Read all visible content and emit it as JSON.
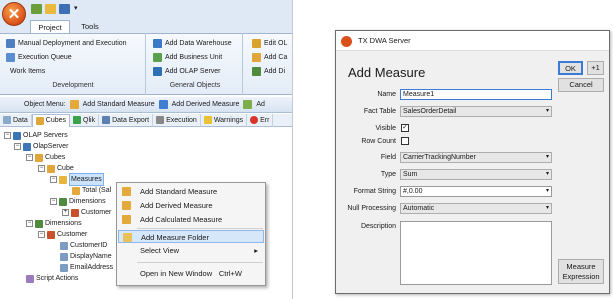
{
  "ribbon": {
    "tabs": [
      "Project",
      "Tools"
    ],
    "development": {
      "items": [
        "Manual Deployment and Execution",
        "Execution Queue",
        "Work Items"
      ],
      "label": "Development"
    },
    "general_objects": {
      "items": [
        "Add Data Warehouse",
        "Add Business Unit",
        "Add OLAP Server"
      ],
      "label": "General Objects"
    },
    "extra": {
      "items": [
        "Edit OL",
        "Add Ca",
        "Add Di"
      ]
    }
  },
  "object_menu": {
    "label": "Object Menu:",
    "items": [
      "Add Standard Measure",
      "Add Derived Measure",
      "Ad"
    ]
  },
  "doc_tabs": [
    "Data",
    "Cubes",
    "Qlik",
    "Data Export",
    "Execution",
    "Warnings",
    "Err"
  ],
  "tree": {
    "olap_servers": "OLAP Servers",
    "olapserver": "OlapServer",
    "cubes": "Cubes",
    "cube": "Cube",
    "measures": "Measures",
    "total": "Total (Sal",
    "dimensions_inner": "Dimensions",
    "customer_inner": "Customer",
    "dimensions": "Dimensions",
    "customer": "Customer",
    "customer_id": "CustomerID",
    "display_name": "DisplayName",
    "email": "EmailAddress",
    "script_actions": "Script Actions"
  },
  "context_menu": {
    "items": [
      "Add Standard Measure",
      "Add Derived Measure",
      "Add Calculated Measure",
      "Add Measure Folder",
      "Select View",
      "Open in New Window"
    ],
    "shortcut": "Ctrl+W",
    "submenu_arrow": "▸"
  },
  "dialog": {
    "title": "TX DWA Server",
    "heading": "Add Measure",
    "ok": "OK",
    "plus": "+1",
    "cancel": "Cancel",
    "labels": {
      "name": "Name",
      "fact_table": "Fact Table",
      "visible": "Visible",
      "row_count": "Row Count",
      "field": "Field",
      "type": "Type",
      "format": "Format String",
      "null": "Null Processing",
      "description": "Description"
    },
    "values": {
      "name": "Measure1",
      "fact_table": "SalesOrderDetail",
      "visible": true,
      "row_count": false,
      "field": "CarrierTrackingNumber",
      "type": "Sum",
      "format": "#,0.00",
      "null": "Automatic",
      "description": ""
    },
    "measure_expression": [
      "Measure",
      "Expression"
    ],
    "check_mark": "✓",
    "dropdown_arrow": "▾"
  },
  "colors": {
    "ribbon_bg": "#dfe9f5",
    "orb": "#d9501a",
    "highlight": "#d6e7f9",
    "selection": "#cce4fb"
  }
}
